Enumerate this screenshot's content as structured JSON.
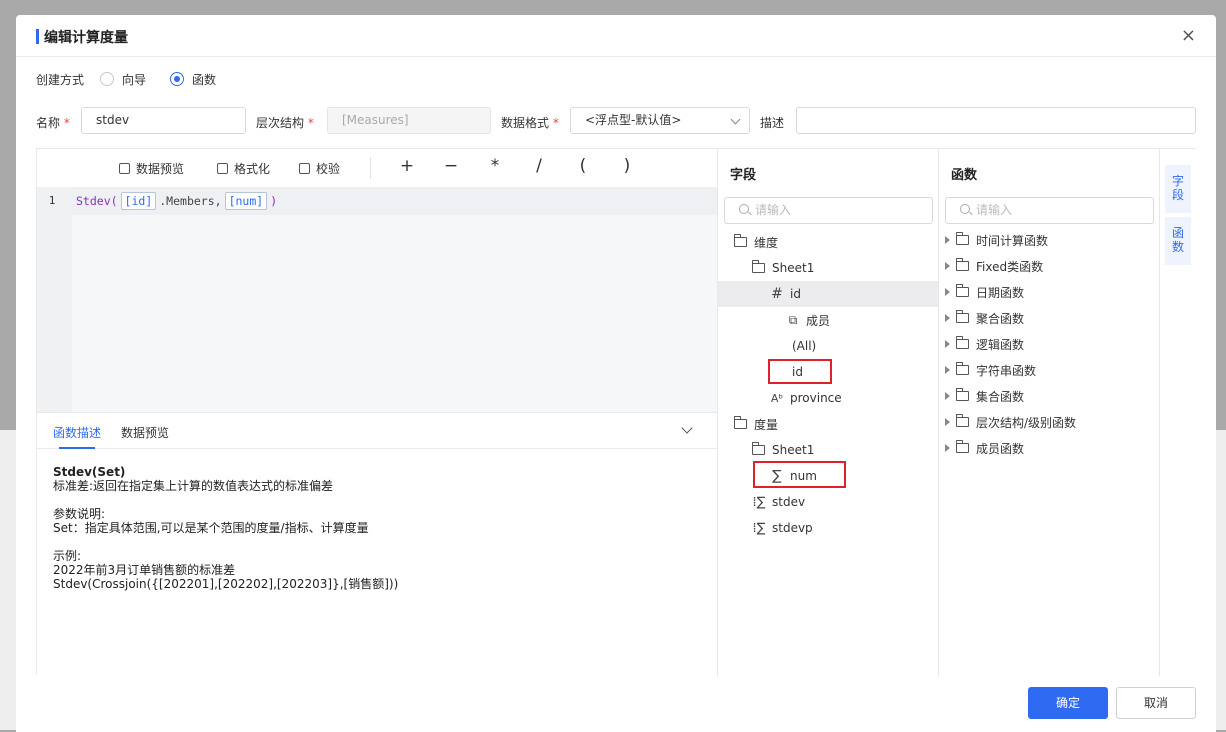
{
  "dialog": {
    "title": "编辑计算度量",
    "close_glyph": "×"
  },
  "create_mode": {
    "label": "创建方式",
    "options": [
      {
        "label": "向导",
        "selected": false
      },
      {
        "label": "函数",
        "selected": true
      }
    ]
  },
  "fields": {
    "name": {
      "label": "名称",
      "value": "stdev"
    },
    "hierarchy": {
      "label": "层次结构",
      "value": "[Measures]"
    },
    "format": {
      "label": "数据格式",
      "value": "<浮点型-默认值>"
    },
    "description": {
      "label": "描述",
      "value": ""
    },
    "required_mark": "*"
  },
  "toolbar": {
    "preview": "数据预览",
    "format": "格式化",
    "validate": "校验",
    "ops": [
      "+",
      "−",
      "*",
      "/",
      "(",
      ")"
    ]
  },
  "editor": {
    "line_number": "1",
    "func": "Stdev(",
    "token1": "[id]",
    "mid": ".Members,",
    "token2": "[num]",
    "close": ")"
  },
  "description_panel": {
    "tabs": [
      "函数描述",
      "数据预览"
    ],
    "signature": "Stdev(Set)",
    "summary": "标准差:返回在指定集上计算的数值表达式的标准偏差",
    "params_title": "参数说明:",
    "params": "Set：指定具体范围,可以是某个范围的度量/指标、计算度量",
    "example_title": "示例:",
    "example_desc": "2022年前3月订单销售额的标准差",
    "example_code": "Stdev(Crossjoin({[202201],[202202],[202203]},[销售额]))"
  },
  "fields_panel": {
    "title": "字段",
    "search_placeholder": "请输入",
    "items": {
      "dimension": "维度",
      "sheet1_dim": "Sheet1",
      "id": "id",
      "members": "成员",
      "all": "(All)",
      "id_level": "id",
      "province": "province",
      "measure": "度量",
      "sheet1_meas": "Sheet1",
      "num": "num",
      "stdev": "stdev",
      "stdevp": "stdevp"
    }
  },
  "functions_panel": {
    "title": "函数",
    "search_placeholder": "请输入",
    "categories": [
      "时间计算函数",
      "Fixed类函数",
      "日期函数",
      "聚合函数",
      "逻辑函数",
      "字符串函数",
      "集合函数",
      "层次结构/级别函数",
      "成员函数"
    ]
  },
  "side_tabs": [
    "字段",
    "函数"
  ],
  "footer": {
    "ok": "确定",
    "cancel": "取消"
  }
}
